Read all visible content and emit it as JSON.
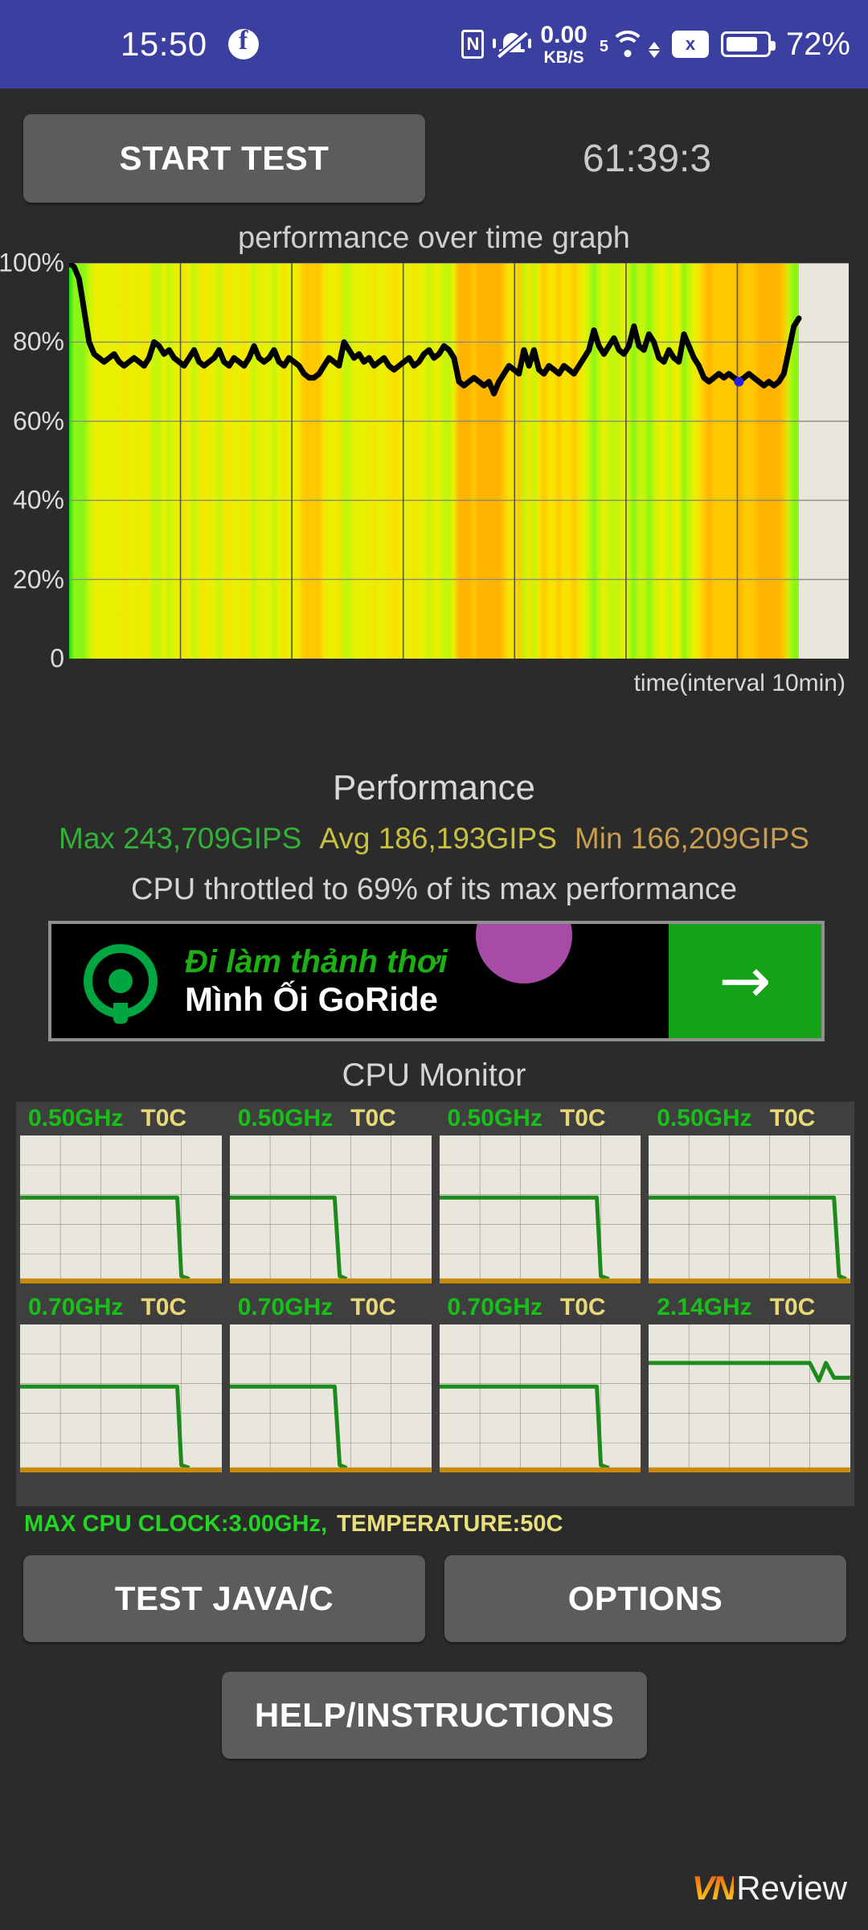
{
  "statusbar": {
    "clock": "15:50",
    "app_icon": "facebook-icon",
    "nfc_label": "N",
    "net_speed_value": "0.00",
    "net_speed_unit": "KB/S",
    "wifi_gen": "5",
    "sim_label": "x",
    "battery_pct": "72%"
  },
  "toolbar": {
    "start_test_label": "START TEST",
    "timer": "61:39:3"
  },
  "chart_data": {
    "type": "area",
    "title": "performance over time graph",
    "xlabel": "time(interval 10min)",
    "ylabel": "",
    "ylim": [
      0,
      100
    ],
    "xlim": [
      0,
      100
    ],
    "grid": true,
    "ytick_labels": [
      "100%",
      "80%",
      "60%",
      "40%",
      "20%",
      "0"
    ],
    "ytick_values": [
      100,
      80,
      60,
      40,
      20,
      0
    ],
    "legend": "none",
    "series": [
      {
        "name": "performance %",
        "values": [
          100,
          99,
          96,
          88,
          80,
          77,
          76,
          75,
          76,
          77,
          75,
          74,
          75,
          76,
          75,
          74,
          76,
          80,
          79,
          77,
          78,
          76,
          75,
          74,
          76,
          78,
          75,
          74,
          75,
          76,
          78,
          75,
          74,
          76,
          75,
          74,
          76,
          79,
          76,
          75,
          76,
          78,
          75,
          74,
          76,
          75,
          74,
          72,
          71,
          71,
          72,
          74,
          76,
          75,
          74,
          80,
          78,
          76,
          77,
          75,
          76,
          74,
          75,
          76,
          74,
          73,
          74,
          75,
          76,
          74,
          75,
          77,
          78,
          76,
          77,
          79,
          78,
          76,
          70,
          69,
          70,
          71,
          70,
          69,
          70,
          67,
          70,
          72,
          74,
          73,
          72,
          78,
          74,
          78,
          73,
          72,
          74,
          73,
          72,
          74,
          73,
          72,
          74,
          76,
          78,
          83,
          79,
          77,
          79,
          81,
          78,
          77,
          79,
          84,
          79,
          78,
          82,
          80,
          76,
          75,
          78,
          76,
          75,
          82,
          79,
          76,
          74,
          71,
          70,
          71,
          72,
          71,
          72,
          71,
          70,
          71,
          72,
          71,
          70,
          69,
          70,
          69,
          70,
          72,
          78,
          84,
          86
        ]
      }
    ],
    "annotations": [
      {
        "text": "area is heat/clock gradient fill (green-yellow-orange)"
      }
    ]
  },
  "performance": {
    "title": "Performance",
    "max_label": "Max",
    "max_value": "243,709GIPS",
    "max_color": "#33b037",
    "avg_label": "Avg",
    "avg_value": "186,193GIPS",
    "avg_color": "#c8c042",
    "min_label": "Min",
    "min_value": "166,209GIPS",
    "min_color": "#c89d50",
    "throttle_text": "CPU throttled to 69% of its max performance"
  },
  "ad": {
    "logo": "gojek-logo-icon",
    "line1": "Đi làm thảnh thơi",
    "line2": "Mình Ối GoRide",
    "cta_icon": "arrow-right-icon",
    "cta_glyph": "→"
  },
  "cpu_monitor": {
    "title": "CPU Monitor",
    "cores": [
      {
        "freq": "0.50GHz",
        "temp": "T0C",
        "line": "drop-late"
      },
      {
        "freq": "0.50GHz",
        "temp": "T0C",
        "line": "drop-mid"
      },
      {
        "freq": "0.50GHz",
        "temp": "T0C",
        "line": "drop-late"
      },
      {
        "freq": "0.50GHz",
        "temp": "T0C",
        "line": "drop-end"
      },
      {
        "freq": "0.70GHz",
        "temp": "T0C",
        "line": "drop-late"
      },
      {
        "freq": "0.70GHz",
        "temp": "T0C",
        "line": "drop-mid"
      },
      {
        "freq": "0.70GHz",
        "temp": "T0C",
        "line": "drop-late"
      },
      {
        "freq": "2.14GHz",
        "temp": "T0C",
        "line": "high-sustained"
      }
    ],
    "max_clock_text": "MAX CPU CLOCK:3.00GHz,",
    "temperature_text": "TEMPERATURE:50C"
  },
  "buttons": {
    "test_java_c": "TEST JAVA/C",
    "options": "OPTIONS",
    "help_instructions": "HELP/INSTRUCTIONS"
  },
  "watermark": {
    "vn": "VN",
    "review": "Review"
  }
}
